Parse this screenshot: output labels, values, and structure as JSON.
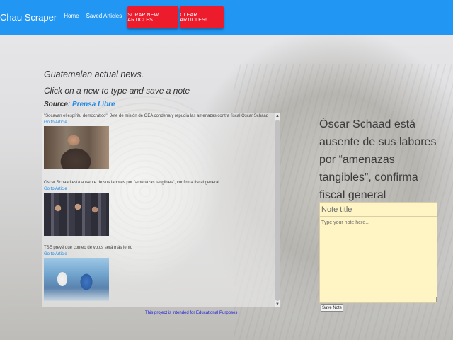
{
  "navbar": {
    "brand": "Chau Scraper",
    "links": [
      "Home",
      "Saved Articles"
    ],
    "scrape_button": "SCRAP NEW ARTICLES",
    "clear_button": "CLEAR ARTICLES!",
    "color": "#2196f3",
    "button_color": "#ec1c2d"
  },
  "header": {
    "line1": "Guatemalan actual news.",
    "line2": "Click on a new to type and save a note",
    "source_label": "Source:",
    "source_name": "Prensa Libre"
  },
  "articles": [
    {
      "title": "\"Socavan el espíritu democrático\": Jefe de misión de OEA condena y repudia las amenazas contra fiscal Óscar Schaad",
      "link": "Go to Article",
      "image": "man-at-desk-photo"
    },
    {
      "title": "Óscar Schaad está ausente de sus labores por \"amenazas tangibles\", confirma fiscal general",
      "link": "Go to Article",
      "image": "press-conference-photo"
    },
    {
      "title": "TSE prevé que conteo de votos será más lento",
      "link": "Go to Article",
      "image": "vote-counting-photo"
    }
  ],
  "footer": {
    "text": "This project is intended for Educational Purposes"
  },
  "note_panel": {
    "selected_title": "Óscar Schaad está ausente de sus labores por “amenazas tangibles”, confirma fiscal general",
    "title_placeholder": "Note title",
    "body_placeholder": "Type your note here...",
    "save_label": "Save Note",
    "note_color": "#fff4c4"
  }
}
